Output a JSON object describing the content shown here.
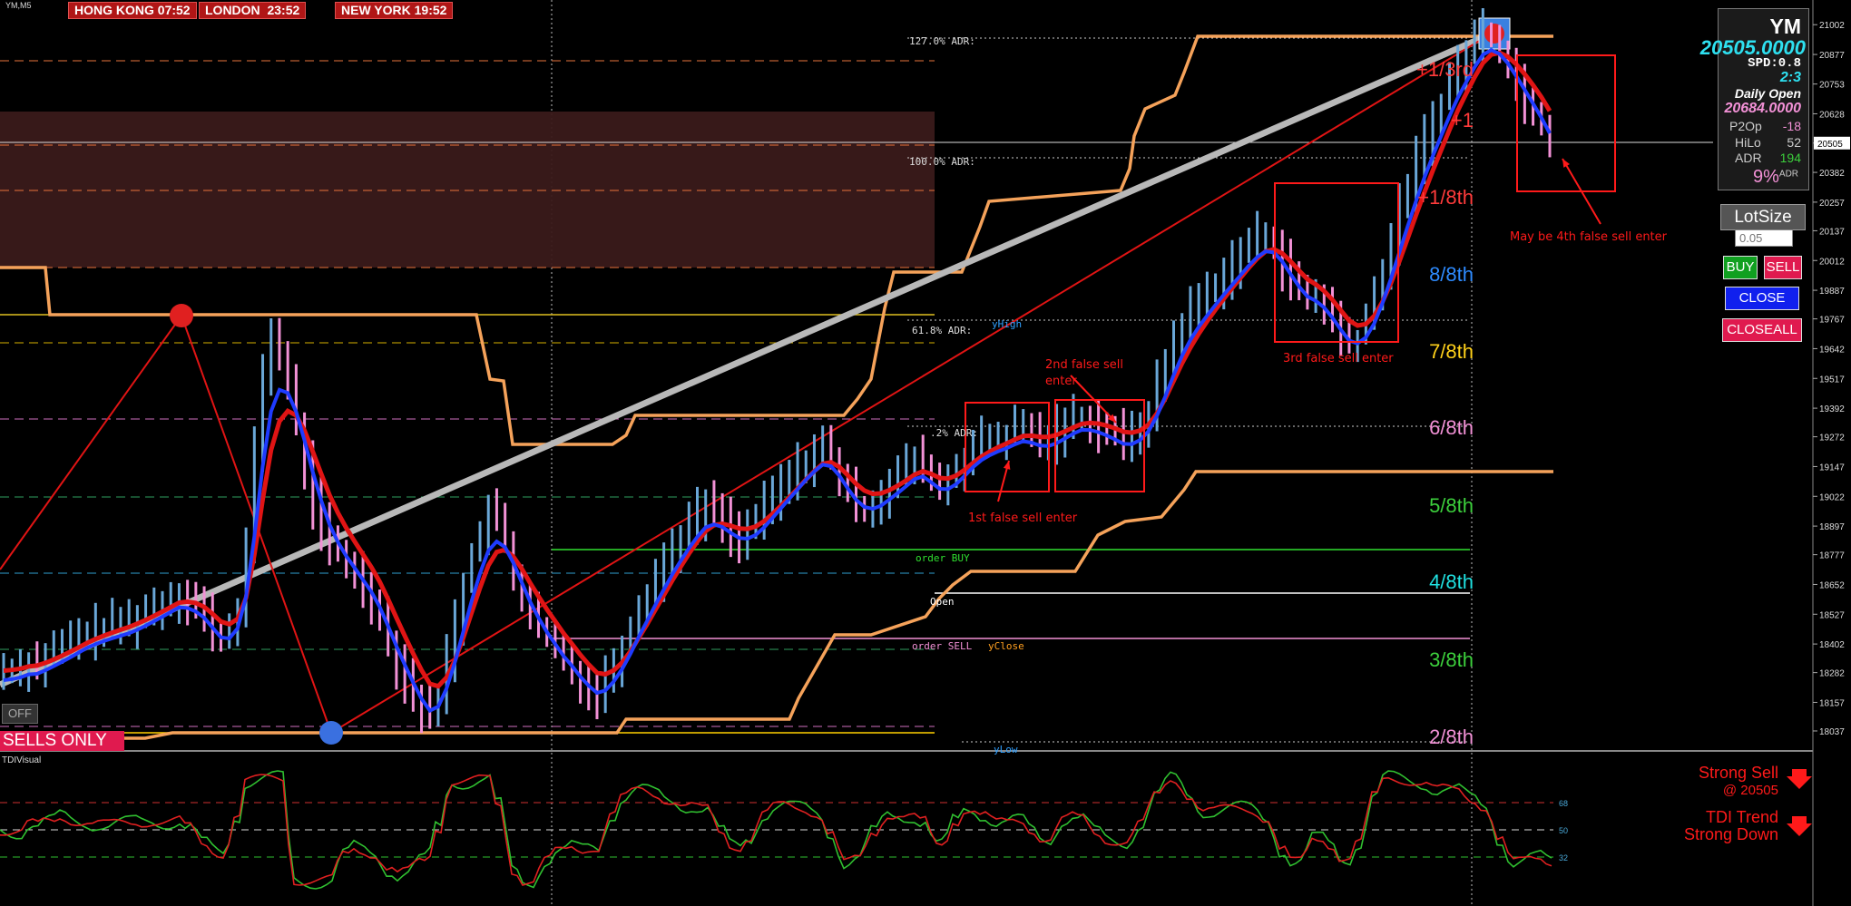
{
  "symbol_label": "YM,M5",
  "sessions": [
    {
      "city": "HONG KONG",
      "time": "07:52"
    },
    {
      "city": "LONDON",
      "time": "23:52"
    },
    {
      "city": "NEW YORK",
      "time": "19:52"
    }
  ],
  "info_panel": {
    "symbol": "YM",
    "price": "20505.0000",
    "spd_label": "SPD:",
    "spd_value": "0.8",
    "ratio": "2:3",
    "daily_open_label": "Daily Open",
    "daily_open": "20684.0000",
    "p2op_label": "P2Op",
    "p2op_value": "-18",
    "hilo_label": "HiLo",
    "hilo_value": "52",
    "adr_label": "ADR",
    "adr_value": "194",
    "adr_pct": "9%",
    "adr_pct_suffix": "ADR"
  },
  "trade_panel": {
    "lot_label": "LotSize",
    "lot_placeholder": "0.05",
    "buy": "BUY",
    "sell": "SELL",
    "close": "CLOSE",
    "closeall": "CLOSEALL"
  },
  "off_button": "OFF",
  "sells_only": "SELLS ONLY",
  "indicator_label": "TDIVisual",
  "signals": {
    "strong_sell": "Strong Sell",
    "strong_sell_price": "@ 20505",
    "tdi_trend": "TDI Trend",
    "tdi_trend_value": "Strong Down"
  },
  "colors": {
    "bull_candle": "#6aa7d8",
    "bear_candle": "#f291d6",
    "fast_ma": "#1f3bff",
    "slow_ma": "#e01414",
    "adr_line": "#f5a25a",
    "trendline": "#b8b8b8",
    "annotation": "#ff1a1a",
    "zone": "#3a1a1a"
  },
  "chart_data": {
    "type": "candlestick",
    "ylim": [
      17976,
      21060
    ],
    "price_axis_ticks": [
      21002,
      20877,
      20753,
      20628,
      20505,
      20382,
      20257,
      20137,
      20012,
      19887,
      19767,
      19642,
      19517,
      19392,
      19272,
      19147,
      19022,
      18897,
      18777,
      18652,
      18527,
      18402,
      18282,
      18157,
      18037
    ],
    "current_price": 20505,
    "murrey_levels": [
      {
        "label": "+1/3rd",
        "price": 20840,
        "color": "#ff3b3b"
      },
      {
        "label": "+1",
        "price": 20590,
        "color": "#ff3b3b"
      },
      {
        "label": "+1/8th",
        "price": 20290,
        "color": "#ff3b3b"
      },
      {
        "label": "8/8th",
        "price": 20020,
        "color": "#2e8bff"
      },
      {
        "label": "7/8th",
        "price": 19680,
        "color": "#ffd11a"
      },
      {
        "label": "6/8th",
        "price": 19345,
        "color": "#f291d6"
      },
      {
        "label": "5/8th",
        "price": 19008,
        "color": "#3ccf3c"
      },
      {
        "label": "4/8th",
        "price": 18675,
        "color": "#20e0e0"
      },
      {
        "label": "3/8th",
        "price": 18340,
        "color": "#3ccf3c"
      },
      {
        "label": "2/8th",
        "price": 18005,
        "color": "#f291d6"
      }
    ],
    "levels": [
      {
        "label": "127.0% ADR:",
        "price": 20930
      },
      {
        "label": "100.0% ADR:",
        "price": 20450
      },
      {
        "label": "61.8% ADR:",
        "price": 19745
      },
      {
        "label": "yHigh",
        "price": 19775
      },
      {
        "label": ".2% ADR:",
        "price": 19375
      },
      {
        "label": "order BUY",
        "price": 18785
      },
      {
        "label": "Open",
        "price": 18630
      },
      {
        "label": "order SELL",
        "price": 18455
      },
      {
        "label": "yClose",
        "price": 18455
      },
      {
        "label": "yLow",
        "price": 18005
      }
    ],
    "annotations": [
      {
        "text": "1st false sell enter"
      },
      {
        "text": "2nd false sell"
      },
      {
        "text": "enter"
      },
      {
        "text": "3rd false sell enter"
      },
      {
        "text": "May be 4th false sell enter"
      }
    ],
    "close_path": [
      18290,
      18300,
      18310,
      18330,
      18320,
      18350,
      18370,
      18390,
      18410,
      18430,
      18450,
      18460,
      18470,
      18480,
      18490,
      18500,
      18520,
      18540,
      18560,
      18580,
      18600,
      18620,
      18590,
      18560,
      18520,
      18460,
      18420,
      18460,
      18560,
      18800,
      19200,
      19550,
      19700,
      19620,
      19480,
      19320,
      19150,
      19000,
      18900,
      18820,
      18780,
      18740,
      18700,
      18650,
      18600,
      18520,
      18420,
      18330,
      18260,
      18190,
      18130,
      18100,
      18200,
      18350,
      18500,
      18650,
      18780,
      18880,
      18950,
      18920,
      18820,
      18700,
      18600,
      18520,
      18470,
      18420,
      18380,
      18330,
      18300,
      18250,
      18220,
      18200,
      18260,
      18330,
      18400,
      18480,
      18560,
      18620,
      18690,
      18750,
      18810,
      18860,
      18910,
      18950,
      18980,
      18960,
      18920,
      18880,
      18860,
      18880,
      18920,
      18970,
      19020,
      19060,
      19100,
      19140,
      19180,
      19210,
      19230,
      19180,
      19100,
      19030,
      18990,
      18980,
      19000,
      19040,
      19080,
      19110,
      19140,
      19170,
      19160,
      19090,
      19060,
      19090,
      19140,
      19190,
      19230,
      19250,
      19260,
      19270,
      19280,
      19300,
      19310,
      19280,
      19260,
      19270,
      19300,
      19330,
      19350,
      19360,
      19340,
      19320,
      19300,
      19280,
      19260,
      19280,
      19320,
      19380,
      19480,
      19580,
      19680,
      19750,
      19800,
      19840,
      19880,
      19920,
      19960,
      20000,
      20040,
      20080,
      20110,
      20120,
      20080,
      20000,
      19930,
      19880,
      19850,
      19860,
      19820,
      19760,
      19700,
      19660,
      19690,
      19760,
      19860,
      19980,
      20100,
      20220,
      20330,
      20430,
      20520,
      20600,
      20680,
      20760,
      20830,
      20880,
      20940,
      20980,
      20960,
      20900,
      20830,
      20760,
      20700,
      20640,
      20580,
      20505
    ]
  }
}
